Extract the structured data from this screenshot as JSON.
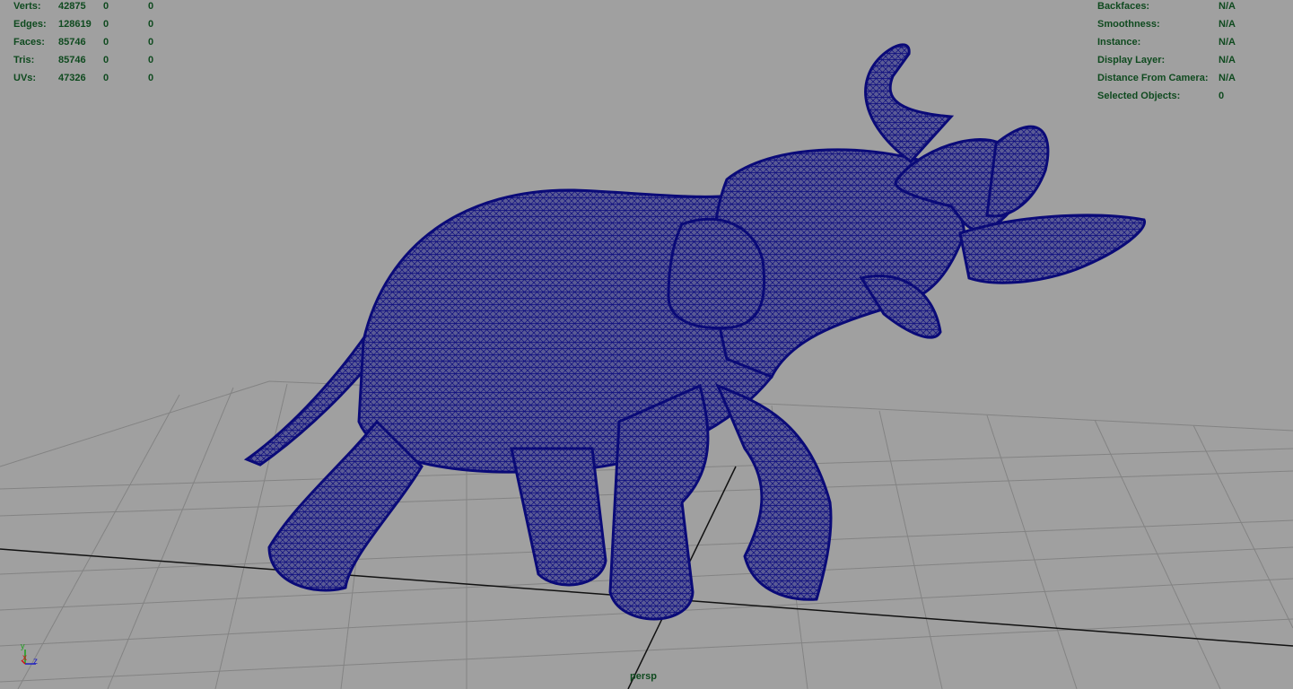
{
  "heads_up_left": [
    {
      "label": "Verts:",
      "v1": "42875",
      "v2": "0",
      "v3": "0"
    },
    {
      "label": "Edges:",
      "v1": "128619",
      "v2": "0",
      "v3": "0"
    },
    {
      "label": "Faces:",
      "v1": "85746",
      "v2": "0",
      "v3": "0"
    },
    {
      "label": "Tris:",
      "v1": "85746",
      "v2": "0",
      "v3": "0"
    },
    {
      "label": "UVs:",
      "v1": "47326",
      "v2": "0",
      "v3": "0"
    }
  ],
  "heads_up_right": [
    {
      "label": "Backfaces:",
      "value": "N/A"
    },
    {
      "label": "Smoothness:",
      "value": "N/A"
    },
    {
      "label": "Instance:",
      "value": "N/A"
    },
    {
      "label": "Display Layer:",
      "value": "N/A"
    },
    {
      "label": "Distance From Camera:",
      "value": "N/A"
    },
    {
      "label": "Selected Objects:",
      "value": "0"
    }
  ],
  "camera": {
    "name": "persp"
  },
  "axis": {
    "y": "y",
    "x": "x",
    "z": "z"
  },
  "colors": {
    "background": "#a0a0a0",
    "grid": "#7e7e7e",
    "mesh": "#0b0b7a",
    "hud": "#0f4a1f"
  }
}
